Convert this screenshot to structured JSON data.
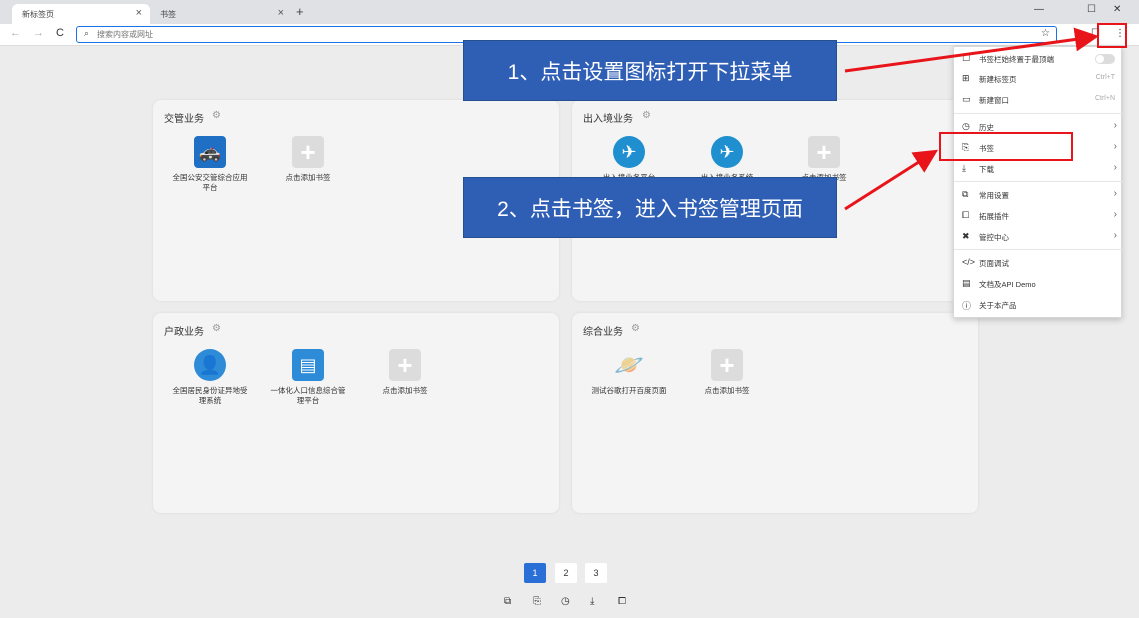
{
  "tabs": [
    {
      "label": "新标签页",
      "close": "×"
    },
    {
      "label": "书签",
      "close": "×"
    }
  ],
  "new_tab_symbol": "+",
  "window_controls": {
    "minimize": "—",
    "maximize": "☐",
    "close": "✕"
  },
  "toolbar": {
    "back": "←",
    "forward": "→",
    "reload": "C",
    "search_symbol": "⌕",
    "address_placeholder": "搜索内容或网址",
    "star": "☆",
    "extension": "☐",
    "menu": "⋮"
  },
  "cards": [
    {
      "title": "交管业务",
      "apps": [
        {
          "label": "全国公安交管综合应用平台",
          "icon": "police-car-icon",
          "glyph": "🚓"
        },
        {
          "label": "点击添加书签",
          "icon": "plus-icon",
          "glyph": "+"
        }
      ]
    },
    {
      "title": "出入境业务",
      "apps": [
        {
          "label": "出入境业务平台",
          "icon": "airplane-icon",
          "glyph": "✈"
        },
        {
          "label": "出入境业务系统",
          "icon": "airplane-icon",
          "glyph": "✈"
        },
        {
          "label": "点击添加书签",
          "icon": "plus-icon",
          "glyph": "+"
        }
      ]
    },
    {
      "title": "户政业务",
      "apps": [
        {
          "label": "全国居民身份证异地受理系统",
          "icon": "id-card-icon",
          "glyph": "👤"
        },
        {
          "label": "一体化人口信息综合管理平台",
          "icon": "document-icon",
          "glyph": "▤"
        },
        {
          "label": "点击添加书签",
          "icon": "plus-icon",
          "glyph": "+"
        }
      ]
    },
    {
      "title": "综合业务",
      "apps": [
        {
          "label": "测试谷歌打开百度页面",
          "icon": "planet-icon",
          "glyph": "🪐"
        },
        {
          "label": "点击添加书签",
          "icon": "plus-icon",
          "glyph": "+"
        }
      ]
    }
  ],
  "pagination": [
    "1",
    "2",
    "3"
  ],
  "bottom_icons": [
    "tab-icon",
    "bookmark-icon",
    "history-icon",
    "download-icon",
    "extension-icon"
  ],
  "bottom_glyphs": [
    "⧉",
    "⎘",
    "◷",
    "⤓",
    "⧠"
  ],
  "menu": {
    "items": [
      {
        "label": "书签栏始终置于最顶端",
        "shortcut": "",
        "icon": "☐",
        "kind": "toggle"
      },
      {
        "label": "新建标签页",
        "shortcut": "Ctrl+T",
        "icon": "⊞",
        "kind": "item"
      },
      {
        "label": "新建窗口",
        "shortcut": "Ctrl+N",
        "icon": "▭",
        "kind": "item"
      },
      {
        "label": "历史",
        "shortcut": "",
        "icon": "◷",
        "kind": "sub"
      },
      {
        "label": "书签",
        "shortcut": "",
        "icon": "⎘",
        "kind": "sub"
      },
      {
        "label": "下载",
        "shortcut": "",
        "icon": "⤓",
        "kind": "sub"
      },
      {
        "label": "常用设置",
        "shortcut": "",
        "icon": "⧉",
        "kind": "sub"
      },
      {
        "label": "拓展插件",
        "shortcut": "",
        "icon": "⧠",
        "kind": "sub"
      },
      {
        "label": "管控中心",
        "shortcut": "",
        "icon": "✖",
        "kind": "sub"
      },
      {
        "label": "页面调试",
        "shortcut": "",
        "icon": "</>",
        "kind": "item"
      },
      {
        "label": "文档及API Demo",
        "shortcut": "",
        "icon": "▤",
        "kind": "item"
      },
      {
        "label": "关于本产品",
        "shortcut": "",
        "icon": "ⓘ",
        "kind": "item"
      }
    ],
    "arrow": "›"
  },
  "callouts": [
    {
      "text": "1、点击设置图标打开下拉菜单"
    },
    {
      "text": "2、点击书签，进入书签管理页面"
    }
  ],
  "colors": {
    "annotation_red": "#e8141a",
    "callout_blue": "#2f5fb4",
    "accent": "#2a6fd6"
  }
}
